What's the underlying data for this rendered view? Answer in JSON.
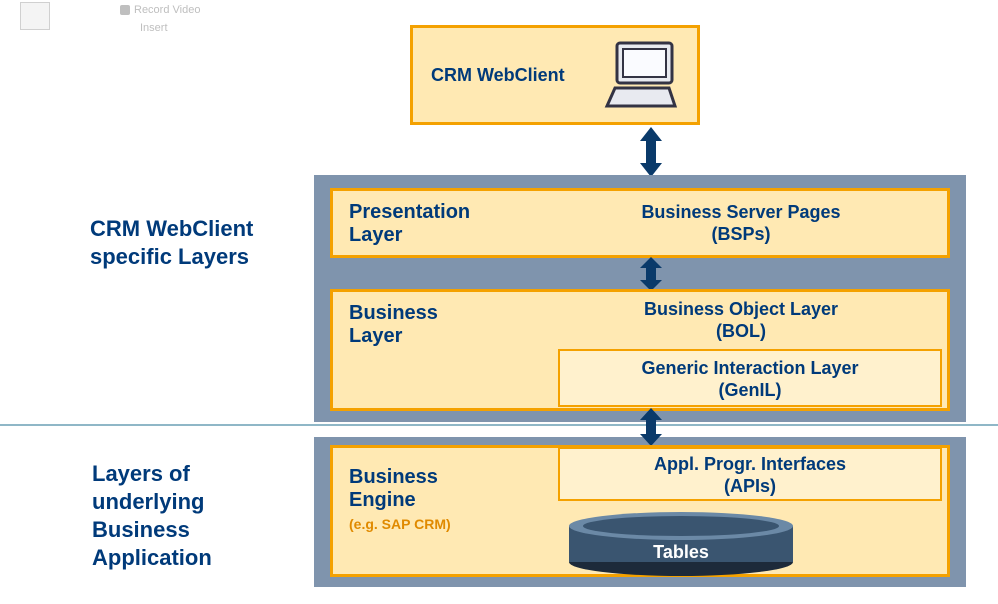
{
  "ribbon": {
    "record_video": "Record Video",
    "insert": "Insert"
  },
  "top_box": {
    "title": "CRM WebClient"
  },
  "left_labels": {
    "group1_line1": "CRM WebClient",
    "group1_line2": "specific Layers",
    "group2_line1": "Layers of",
    "group2_line2": "underlying",
    "group2_line3": "Business",
    "group2_line4": "Application"
  },
  "layers": {
    "presentation": {
      "title": "Presentation",
      "sub": "Layer",
      "right_line1": "Business Server Pages",
      "right_line2": "(BSPs)"
    },
    "business": {
      "title": "Business",
      "sub": "Layer",
      "right1_line1": "Business Object Layer",
      "right1_line2": "(BOL)",
      "right2_line1": "Generic Interaction Layer",
      "right2_line2": "(GenIL)"
    },
    "engine": {
      "title": "Business",
      "sub": "Engine",
      "note": "(e.g. SAP CRM)",
      "right_line1": "Appl. Progr. Interfaces",
      "right_line2": "(APIs)",
      "tables": "Tables"
    }
  }
}
